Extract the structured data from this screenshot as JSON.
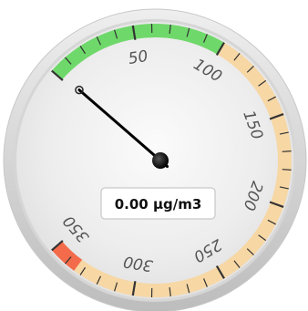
{
  "chart_data": {
    "type": "gauge",
    "value": 0.0,
    "unit": "µg/m3",
    "display_value": "0.00 µg/m3",
    "min": 0,
    "max": 350,
    "tick_labels": [
      "50",
      "100",
      "150",
      "200",
      "250",
      "300",
      "350"
    ],
    "bands": [
      {
        "from": 0,
        "to": 100,
        "color": "#6fd86a"
      },
      {
        "from": 100,
        "to": 334,
        "color": "#f7d7a4"
      },
      {
        "from": 334,
        "to": 350,
        "color": "#f36b4a"
      }
    ]
  }
}
